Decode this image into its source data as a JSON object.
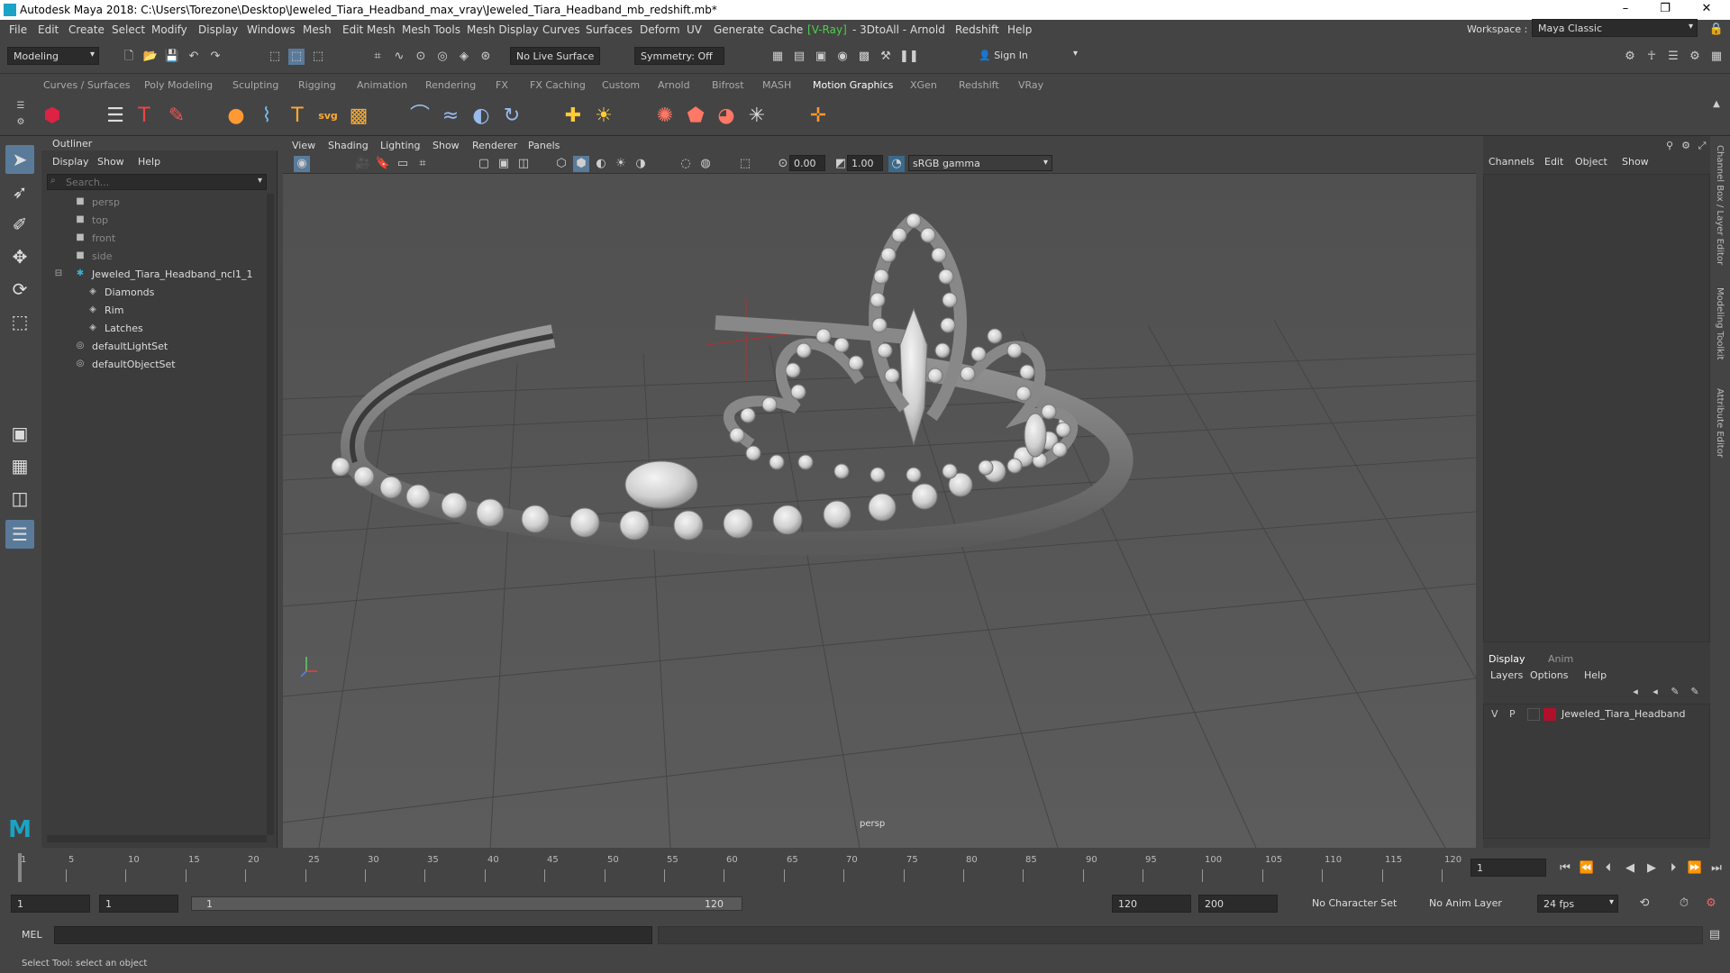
{
  "titlebar": {
    "title": "Autodesk Maya 2018: C:\\Users\\Torezone\\Desktop\\Jeweled_Tiara_Headband_max_vray\\Jeweled_Tiara_Headband_mb_redshift.mb*",
    "minimize": "–",
    "restore": "❐",
    "close": "✕"
  },
  "menubar": {
    "items": [
      "File",
      "Edit",
      "Create",
      "Select",
      "Modify",
      "Display",
      "Windows",
      "Mesh",
      "Edit Mesh",
      "Mesh Tools",
      "Mesh Display",
      "Curves",
      "Surfaces",
      "Deform",
      "UV",
      "Generate",
      "Cache",
      "V-Ray",
      "- 3DtoAll -",
      "Arnold",
      "Redshift",
      "Help"
    ],
    "workspace_label": "Workspace :",
    "workspace_value": "Maya Classic"
  },
  "toolbar": {
    "mode": "Modeling",
    "live_surface": "No Live Surface",
    "symmetry": "Symmetry: Off",
    "sign_in": "Sign In"
  },
  "shelf": {
    "tabs": [
      "Curves / Surfaces",
      "Poly Modeling",
      "Sculpting",
      "Rigging",
      "Animation",
      "Rendering",
      "FX",
      "FX Caching",
      "Custom",
      "Arnold",
      "Bifrost",
      "MASH",
      "Motion Graphics",
      "XGen",
      "Redshift",
      "VRay"
    ],
    "active_tab": "Motion Graphics",
    "svg_label": "svg"
  },
  "outliner": {
    "title": "Outliner",
    "menu": [
      "Display",
      "Show",
      "Help"
    ],
    "search_placeholder": "Search...",
    "items": [
      {
        "label": "persp",
        "icon": "camera-icon",
        "indent": 0,
        "dim": true
      },
      {
        "label": "top",
        "icon": "camera-icon",
        "indent": 0,
        "dim": true
      },
      {
        "label": "front",
        "icon": "camera-icon",
        "indent": 0,
        "dim": true
      },
      {
        "label": "side",
        "icon": "camera-icon",
        "indent": 0,
        "dim": true
      },
      {
        "label": "Jeweled_Tiara_Headband_ncl1_1",
        "icon": "group-icon",
        "indent": 0,
        "dim": false
      },
      {
        "label": "Diamonds",
        "icon": "mesh-icon",
        "indent": 1,
        "dim": false
      },
      {
        "label": "Rim",
        "icon": "mesh-icon",
        "indent": 1,
        "dim": false
      },
      {
        "label": "Latches",
        "icon": "mesh-icon",
        "indent": 1,
        "dim": false
      },
      {
        "label": "defaultLightSet",
        "icon": "set-icon",
        "indent": 0,
        "dim": false
      },
      {
        "label": "defaultObjectSet",
        "icon": "set-icon",
        "indent": 0,
        "dim": false
      }
    ]
  },
  "viewport": {
    "menu": [
      "View",
      "Shading",
      "Lighting",
      "Show",
      "Renderer",
      "Panels"
    ],
    "exposure": "0.00",
    "gamma": "1.00",
    "color_space": "sRGB gamma",
    "camera_label": "persp"
  },
  "channelbox": {
    "menu": [
      "Channels",
      "Edit",
      "Object",
      "Show"
    ],
    "layer_tabs": [
      "Display",
      "Anim"
    ],
    "layer_menu": [
      "Layers",
      "Options",
      "Help"
    ],
    "layer": {
      "v": "V",
      "p": "P",
      "name": "Jeweled_Tiara_Headband",
      "color": "#b0102a"
    }
  },
  "rightstrip": {
    "labels": [
      "Channel Box / Layer Editor",
      "Modeling Toolkit",
      "Attribute Editor"
    ]
  },
  "timeline": {
    "ticks": [
      "1",
      "5",
      "10",
      "15",
      "20",
      "25",
      "30",
      "35",
      "40",
      "45",
      "50",
      "55",
      "60",
      "65",
      "70",
      "75",
      "80",
      "85",
      "90",
      "95",
      "100",
      "105",
      "110",
      "115",
      "120"
    ],
    "current_frame": "1"
  },
  "range": {
    "start": "1",
    "playback_start": "1",
    "slider_start": "1",
    "slider_end": "120",
    "playback_end": "120",
    "end": "200",
    "character_set": "No Character Set",
    "anim_layer": "No Anim Layer",
    "fps": "24 fps"
  },
  "mel": {
    "label": "MEL"
  },
  "status": {
    "text": "Select Tool: select an object"
  },
  "colors": {
    "accent": "#5a7a9a",
    "vray_green": "#4ad04a",
    "maya_teal": "#1aa3c4"
  }
}
